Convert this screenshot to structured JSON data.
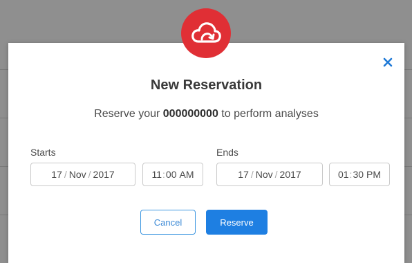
{
  "modal": {
    "title": "New Reservation",
    "subtitle_prefix": "Reserve your ",
    "subtitle_bold": "000000000",
    "subtitle_suffix": " to perform analyses"
  },
  "starts": {
    "label": "Starts",
    "date": {
      "day": "17",
      "month": "Nov",
      "year": "2017"
    },
    "time": {
      "hour": "11",
      "minute": "00",
      "ampm": "AM"
    }
  },
  "ends": {
    "label": "Ends",
    "date": {
      "day": "17",
      "month": "Nov",
      "year": "2017"
    },
    "time": {
      "hour": "01",
      "minute": "30",
      "ampm": "PM"
    }
  },
  "separators": {
    "date": "/",
    "time": ":"
  },
  "buttons": {
    "cancel": "Cancel",
    "reserve": "Reserve"
  },
  "icons": {
    "logo": "cloud-refresh-icon",
    "close": "close-icon"
  },
  "colors": {
    "accent": "#1e7fe2",
    "logo_bg": "#e02f35",
    "close": "#1e78d6"
  }
}
